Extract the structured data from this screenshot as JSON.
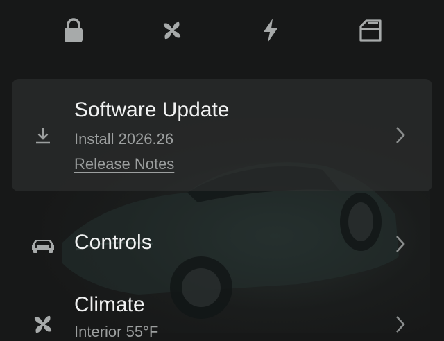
{
  "colors": {
    "background": "#171818",
    "card": "#2e3030",
    "primary_text": "#f0f1f1",
    "secondary_text": "#9c9f9f",
    "icon": "#a7aaaa"
  },
  "topbar": {
    "icons": [
      "lock-icon",
      "fan-icon",
      "lightning-bolt-icon",
      "frunk-icon"
    ]
  },
  "update_card": {
    "icon": "download-icon",
    "title": "Software Update",
    "version": "Install 2026.26",
    "release_notes_label": "Release Notes"
  },
  "rows": [
    {
      "id": "controls",
      "icon": "car-icon",
      "label": "Controls",
      "sublabel": ""
    },
    {
      "id": "climate",
      "icon": "fan-icon",
      "label": "Climate",
      "sublabel": "Interior 55°F"
    }
  ]
}
